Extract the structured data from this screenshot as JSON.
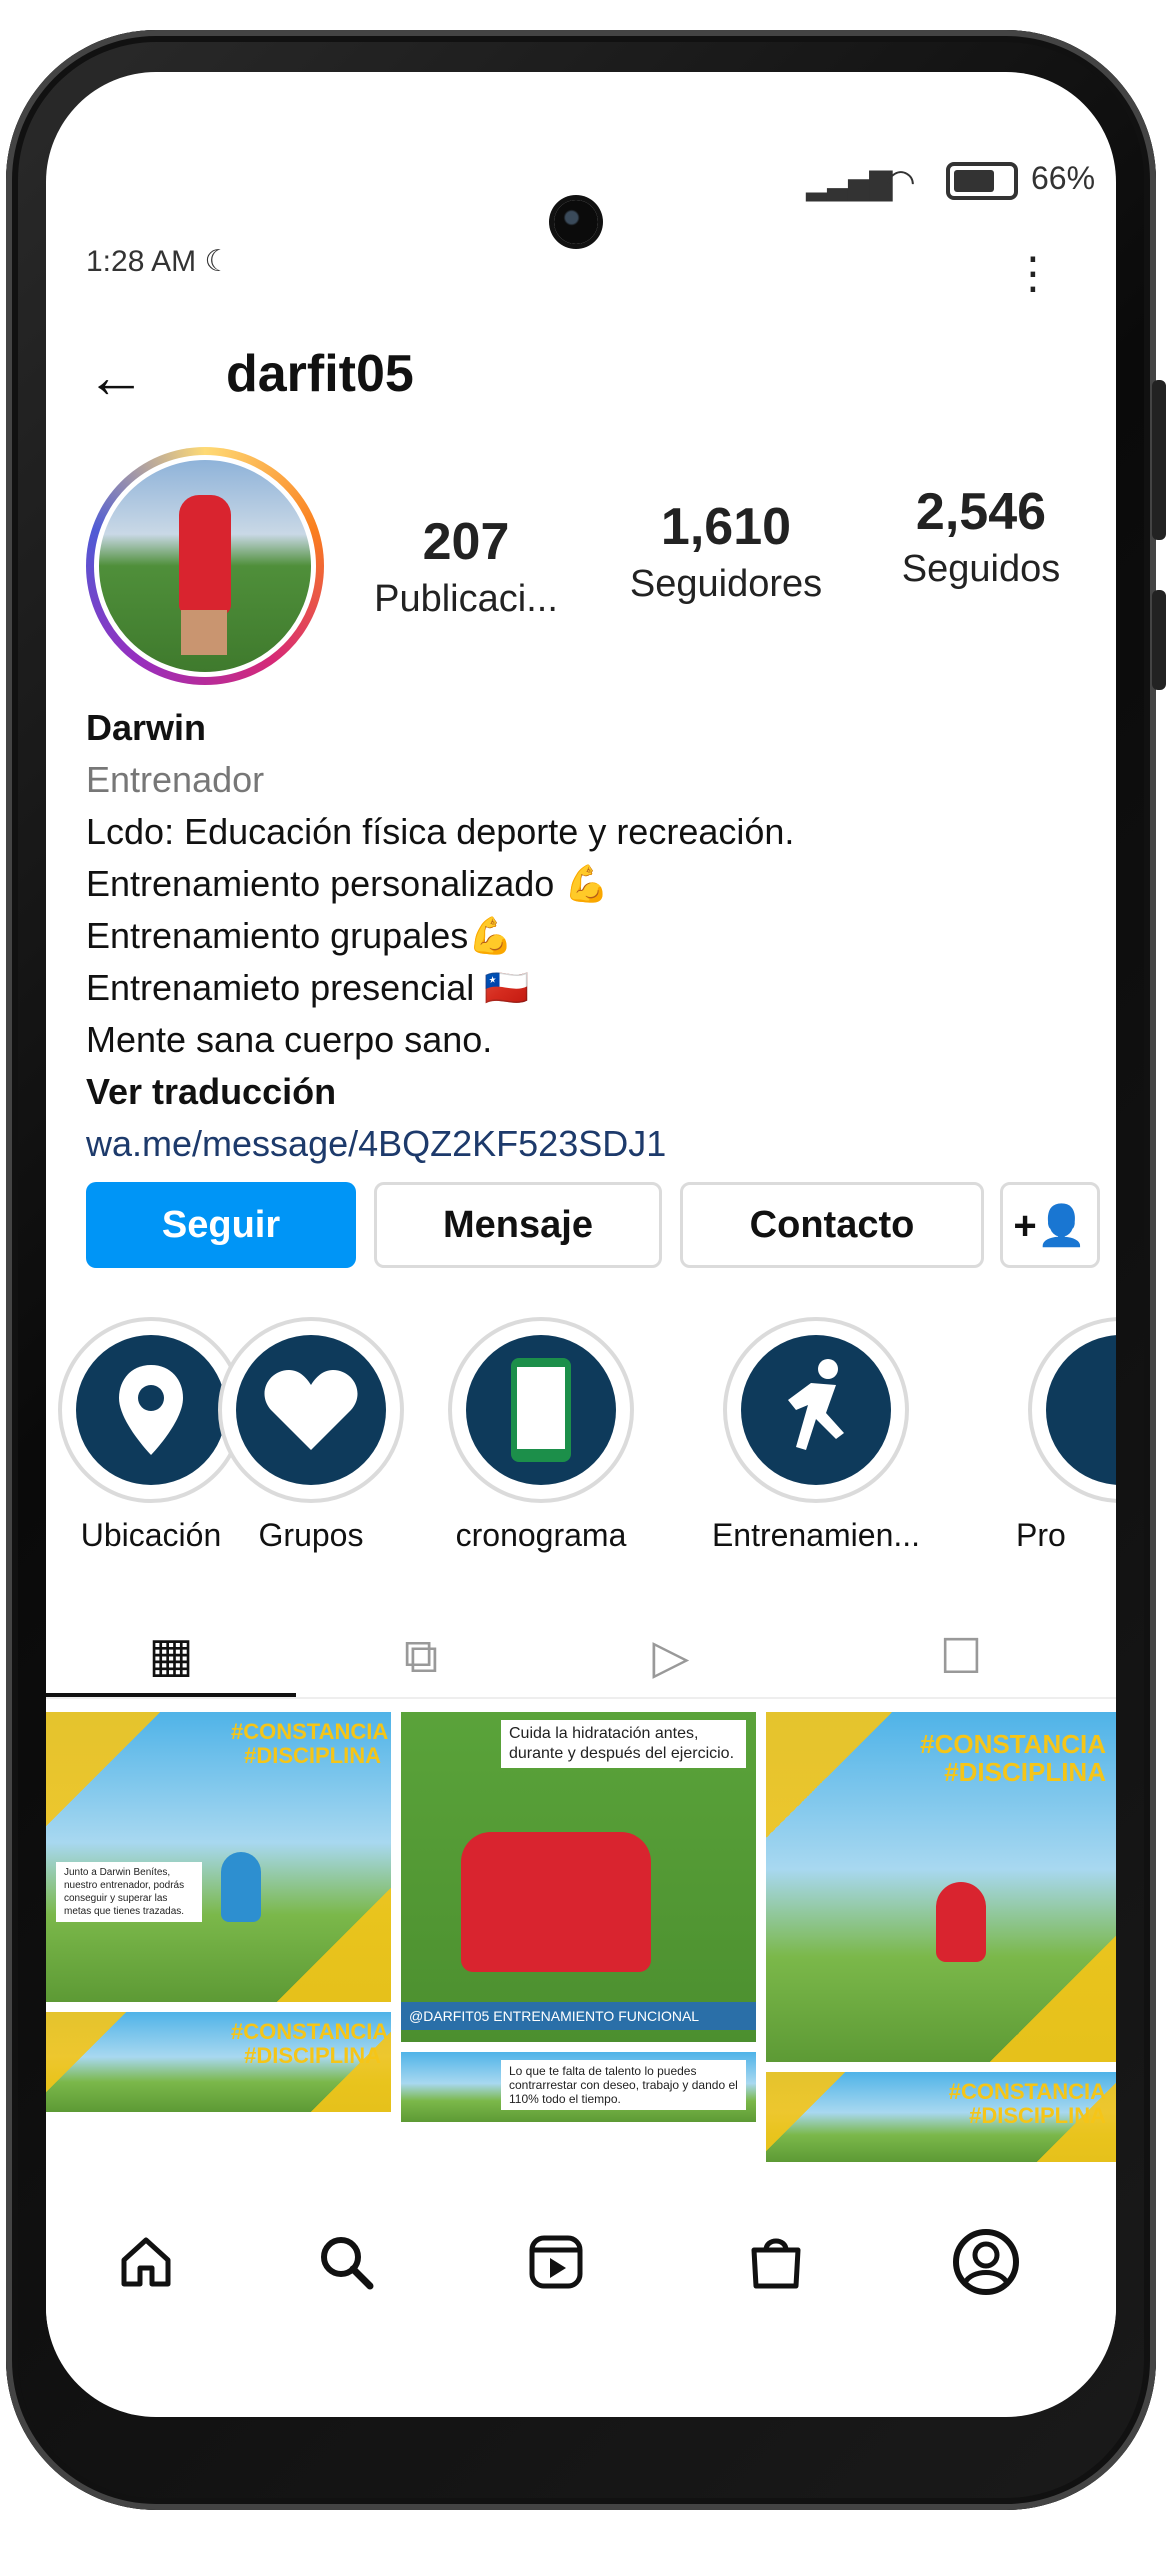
{
  "status": {
    "time": "1:28 AM",
    "battery_pct": "66%",
    "icons": [
      "moon-icon",
      "signal-icon",
      "wifi-icon",
      "battery-icon"
    ]
  },
  "header": {
    "username": "darfit05",
    "back_icon": "arrow-left-icon",
    "menu_icon": "kebab-icon"
  },
  "stats": [
    {
      "value": "207",
      "label": "Publicaci..."
    },
    {
      "value": "1,610",
      "label": "Seguidores"
    },
    {
      "value": "2,546",
      "label": "Seguidos"
    }
  ],
  "bio": {
    "name": "Darwin",
    "category": "Entrenador",
    "lines": [
      "Lcdo: Educación física deporte y recreación.",
      "Entrenamiento personalizado 💪",
      "Entrenamiento grupales💪",
      "Entrenamieto presencial 🇨🇱",
      "Mente sana cuerpo sano."
    ],
    "translate": "Ver traducción",
    "link": "wa.me/message/4BQZ2KF523SDJ1"
  },
  "actions": {
    "follow": "Seguir",
    "message": "Mensaje",
    "contact": "Contacto",
    "add_user_icon": "+👤"
  },
  "highlights": [
    {
      "label": "Ubicación",
      "icon": "location-pin-icon"
    },
    {
      "label": "Grupos",
      "icon": "heart-icon"
    },
    {
      "label": "cronograma",
      "icon": "phone-icon"
    },
    {
      "label": "Entrenamien...",
      "icon": "runner-icon"
    },
    {
      "label": "Pro",
      "icon": "partial-icon"
    }
  ],
  "tabs": [
    {
      "name": "grid",
      "icon": "grid-icon",
      "active": true
    },
    {
      "name": "reels",
      "icon": "reels-icon",
      "active": false
    },
    {
      "name": "video",
      "icon": "play-icon",
      "active": false
    },
    {
      "name": "tagged",
      "icon": "tagged-icon",
      "active": false
    }
  ],
  "posts": [
    {
      "tag": "#CONSTANCIA #DISCIPLINA",
      "text": "Junto a Darwin Benítes, nuestro entrenador, podrás conseguir y superar las metas que tienes trazadas."
    },
    {
      "caption": "Cuida la hidratación antes, durante y después del ejercicio.",
      "handle": "@DARFIT05 ENTRENAMIENTO FUNCIONAL"
    },
    {
      "tag": "#CONSTANCIA #DISCIPLINA"
    },
    {
      "tag": "#CONSTANCIA #DISCIPLINA"
    },
    {
      "caption": "Lo que te falta de talento lo puedes contrarrestar con deseo, trabajo y dando el 110% todo el tiempo."
    },
    {
      "tag": "#CONSTANCIA #DISCIPLINA"
    }
  ],
  "bottom_nav": [
    "home-icon",
    "search-icon",
    "reels-icon",
    "shop-icon",
    "profile-icon"
  ]
}
